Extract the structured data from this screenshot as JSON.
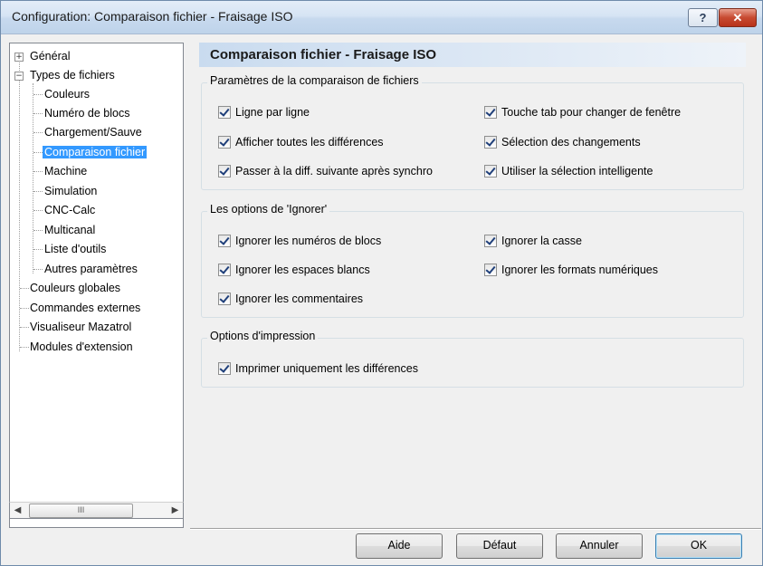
{
  "window": {
    "title": "Configuration: Comparaison fichier - Fraisage ISO",
    "help_label": "?",
    "close_label": "✕"
  },
  "tree": {
    "root_items": [
      {
        "label": "Général",
        "expander": "+"
      },
      {
        "label": "Types de fichiers",
        "expander": "−"
      }
    ],
    "children": [
      "Couleurs",
      "Numéro de blocs",
      "Chargement/Sauve",
      "Comparaison fichier",
      "Machine",
      "Simulation",
      "CNC-Calc",
      "Multicanal",
      "Liste d'outils",
      "Autres paramètres"
    ],
    "selected": "Comparaison fichier",
    "other_items": [
      "Couleurs globales",
      "Commandes externes",
      "Visualiseur Mazatrol",
      "Modules d'extension"
    ],
    "scroll": {
      "left": "◀",
      "right": "▶",
      "thumb": "III"
    }
  },
  "page": {
    "header": "Comparaison fichier - Fraisage ISO",
    "groups": [
      {
        "title": "Paramètres de la comparaison de fichiers",
        "options": [
          {
            "label": "Ligne par ligne",
            "checked": true
          },
          {
            "label": "Touche tab pour changer de fenêtre",
            "checked": true
          },
          {
            "label": "Afficher toutes les différences",
            "checked": true
          },
          {
            "label": "Sélection des changements",
            "checked": true
          },
          {
            "label": "Passer à la diff. suivante après synchro",
            "checked": true
          },
          {
            "label": "Utiliser la sélection intelligente",
            "checked": true
          }
        ]
      },
      {
        "title": "Les options de 'Ignorer'",
        "options": [
          {
            "label": "Ignorer les numéros de blocs",
            "checked": true
          },
          {
            "label": "Ignorer la casse",
            "checked": true
          },
          {
            "label": "Ignorer les espaces blancs",
            "checked": true
          },
          {
            "label": "Ignorer les formats numériques",
            "checked": true
          },
          {
            "label": "Ignorer les commentaires",
            "checked": true
          }
        ]
      },
      {
        "title": "Options d'impression",
        "options": [
          {
            "label": "Imprimer uniquement les différences",
            "checked": true
          }
        ]
      }
    ]
  },
  "buttons": {
    "help": "Aide",
    "default": "Défaut",
    "cancel": "Annuler",
    "ok": "OK"
  }
}
